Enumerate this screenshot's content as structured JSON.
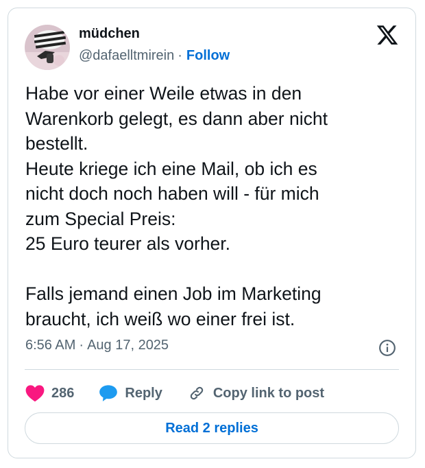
{
  "author": {
    "display_name": "müdchen",
    "handle": "@dafaelltmirein",
    "separator": "·",
    "follow_label": "Follow"
  },
  "tweet": {
    "text": "Habe vor einer Weile etwas in den\nWarenkorb gelegt, es dann aber nicht\nbestellt.\nHeute kriege ich eine Mail, ob ich es\nnicht doch noch haben will - für mich\nzum Special Preis:\n25 Euro teurer als vorher.\n\nFalls jemand einen Job im Marketing\nbraucht, ich weiß wo einer frei ist."
  },
  "meta": {
    "time": "6:56 AM",
    "separator": "·",
    "date": "Aug 17, 2025"
  },
  "actions": {
    "like_count": "286",
    "reply_label": "Reply",
    "copy_link_label": "Copy link to post"
  },
  "read_replies_label": "Read 2 replies",
  "icons": {
    "brand": "x-logo-icon",
    "info": "info-icon",
    "like": "heart-icon",
    "reply": "speech-bubble-icon",
    "copy": "link-icon"
  },
  "colors": {
    "heart": "#f91880",
    "reply_bubble": "#1d9bf0",
    "link_blue": "#006fd6",
    "muted": "#536471",
    "border": "#cfd9de"
  }
}
